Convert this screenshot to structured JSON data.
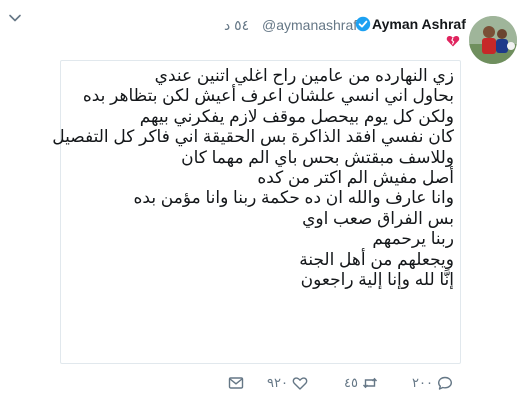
{
  "tweet": {
    "author_name": "Ayman Ashraf",
    "handle": "@aymanashraf",
    "time": "٥٤ د",
    "lines": [
      "زي النهارده من عامين راح اغلي اتنين عندي",
      "بحاول اني انسي علشان اعرف أعيش  لكن بتظاهر بده",
      "ولكن كل يوم بيحصل موقف لازم يفكرني بيهم",
      "كان نفسي افقد الذاكرة بس الحقيقة اني فاكر كل  التفصيل",
      "وللاسف مبقتش بحس باي الم مهما كان",
      "أصل مفيش الم اكتر من كده",
      "وانا عارف والله ان ده حكمة ربنا  وانا مؤمن بده",
      "بس الفراق  صعب اوي",
      "ربنا يرحمهم",
      "ويجعلهم من أهل الجنة",
      "إنَّا لله وإنا إلية راجعون"
    ]
  },
  "actions": {
    "replies": "٢٠٠",
    "retweets": "٤٥",
    "likes": "٩٢٠"
  },
  "icons": {
    "verified": "verified-badge-icon",
    "heart_broken": "broken-heart-icon",
    "menu": "chevron-down-icon",
    "reply": "reply-icon",
    "retweet": "retweet-icon",
    "like": "heart-icon",
    "message": "direct-message-icon"
  },
  "colors": {
    "verified": "#1da1f2",
    "muted": "#657786",
    "broken_heart": "#e0245e"
  }
}
